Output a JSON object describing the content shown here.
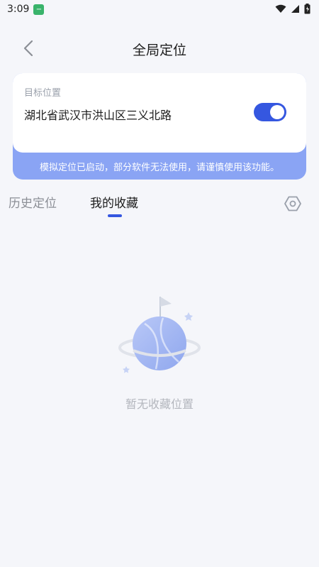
{
  "status_bar": {
    "time": "3:09",
    "app_icon": "app-badge-icon",
    "icons": [
      "wifi-icon",
      "signal-icon",
      "battery-icon"
    ]
  },
  "header": {
    "back_icon": "chevron-left-icon",
    "title": "全局定位"
  },
  "location_card": {
    "label": "目标位置",
    "address": "湖北省武汉市洪山区三义北路",
    "toggle_on": true
  },
  "notice": {
    "text": "模拟定位已启动，部分软件无法使用，请谨慎使用该功能。"
  },
  "tabs": [
    {
      "label": "历史定位",
      "active": false
    },
    {
      "label": "我的收藏",
      "active": true
    }
  ],
  "settings_icon": "hexagon-settings-icon",
  "empty_state": {
    "illustration": "planet-flag-icon",
    "text": "暂无收藏位置"
  },
  "colors": {
    "accent": "#3557e0",
    "notice_bg": "#8aa4f4",
    "page_bg": "#f5f6fa",
    "muted_text": "#9aa0ab"
  }
}
